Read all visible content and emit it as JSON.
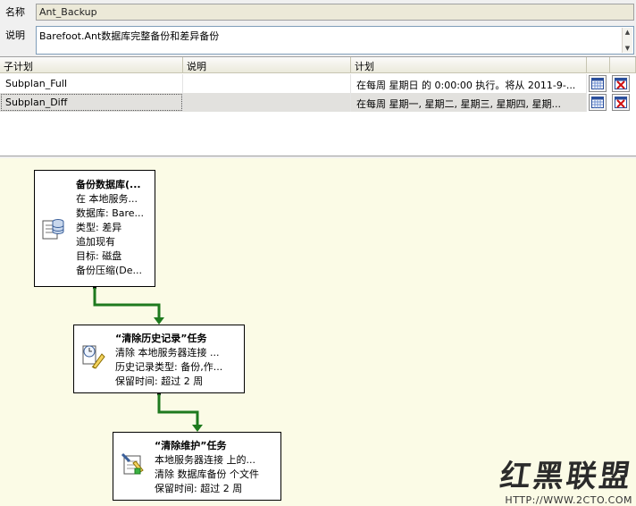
{
  "properties": {
    "name_label": "名称",
    "name_value": "Ant_Backup",
    "desc_label": "说明",
    "desc_value": "Barefoot.Ant数据库完整备份和差异备份"
  },
  "subplans": {
    "headers": [
      "子计划",
      "说明",
      "计划"
    ],
    "rows": [
      {
        "name": "Subplan_Full",
        "description": "",
        "schedule": "在每周 星期日 的 0:00:00 执行。将从 2011-9-..."
      },
      {
        "name": "Subplan_Diff",
        "description": "",
        "schedule": "在每周 星期一, 星期二, 星期三, 星期四, 星期..."
      }
    ]
  },
  "tasks": [
    {
      "title": "备份数据库(...",
      "lines": [
        "在 本地服务...",
        "数据库: Bare...",
        "类型: 差异",
        "追加现有",
        "目标: 磁盘",
        "备份压缩(De..."
      ]
    },
    {
      "title": "“清除历史记录”任务",
      "lines": [
        "清除 本地服务器连接 ...",
        "历史记录类型: 备份,作...",
        "保留时间: 超过 2 周"
      ]
    },
    {
      "title": "“清除维护”任务",
      "lines": [
        "本地服务器连接 上的...",
        "清除 数据库备份 个文件",
        "保留时间: 超过 2 周"
      ]
    }
  ],
  "icons": {
    "schedule_button": "calendar-icon",
    "delete_schedule_button": "delete-schedule-icon",
    "backup_task": "backup-database-icon",
    "history_task": "history-cleanup-icon",
    "maintenance_task": "maintenance-cleanup-icon"
  },
  "colors": {
    "canvas_bg": "#fbfbe6",
    "connector": "#1e7a1e"
  },
  "watermark": {
    "logo": "红黑联盟",
    "url": "HTTP://WWW.2CTO.COM"
  }
}
